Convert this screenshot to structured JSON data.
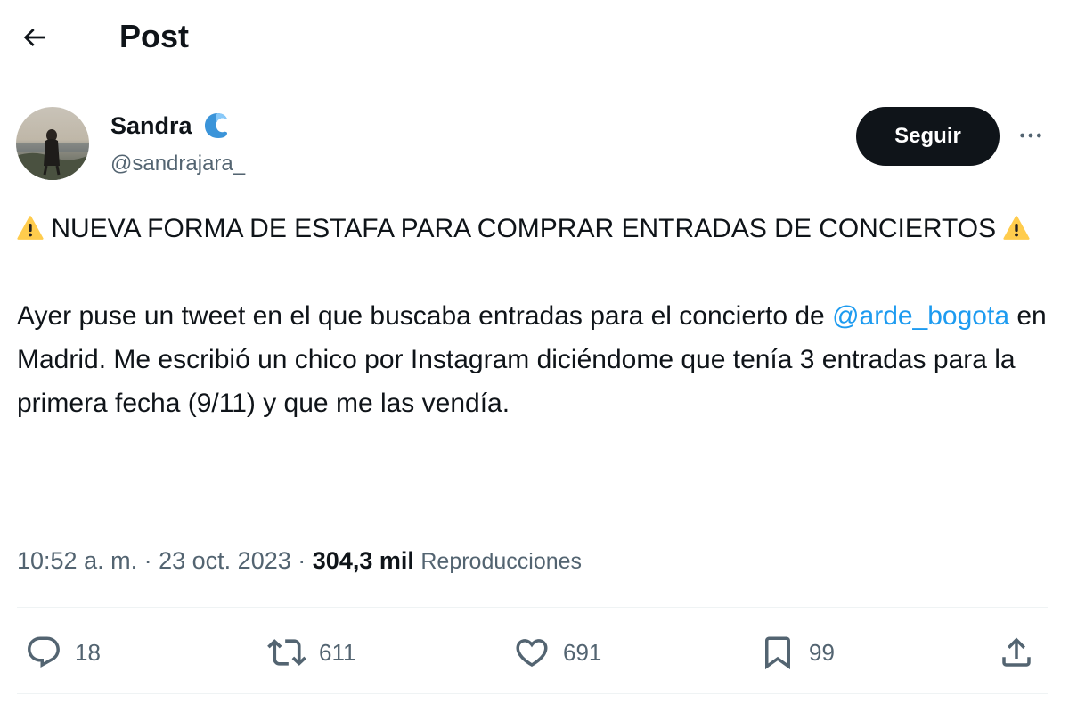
{
  "header": {
    "title": "Post",
    "back_icon": "arrow-left-icon"
  },
  "author": {
    "name": "Sandra",
    "handle": "@sandrajara_",
    "badge_icon": "wave-emoji-icon",
    "follow_label": "Seguir",
    "more_icon": "more-horizontal-icon"
  },
  "post": {
    "warning_icon": "warning-emoji-icon",
    "headline": "NUEVA FORMA DE ESTAFA PARA COMPRAR ENTRADAS DE CONCIERTOS",
    "body_before_mention": "Ayer puse un tweet en el que buscaba entradas para el concierto de ",
    "mention": "@arde_bogota",
    "body_after_mention": " en Madrid. Me escribió un chico por Instagram diciéndome que tenía 3 entradas para la primera fecha (9/11) y que me las vendía."
  },
  "meta": {
    "time": "10:52 a. m.",
    "separator": "·",
    "date": "23 oct. 2023",
    "views": "304,3 mil",
    "views_label": "Reproducciones"
  },
  "actions": {
    "reply_count": "18",
    "repost_count": "611",
    "like_count": "691",
    "bookmark_count": "99"
  },
  "colors": {
    "accent": "#1d9bf0",
    "text": "#0f1419",
    "secondary": "#536471",
    "divider": "#eff3f4",
    "follow_bg": "#0f1419"
  }
}
